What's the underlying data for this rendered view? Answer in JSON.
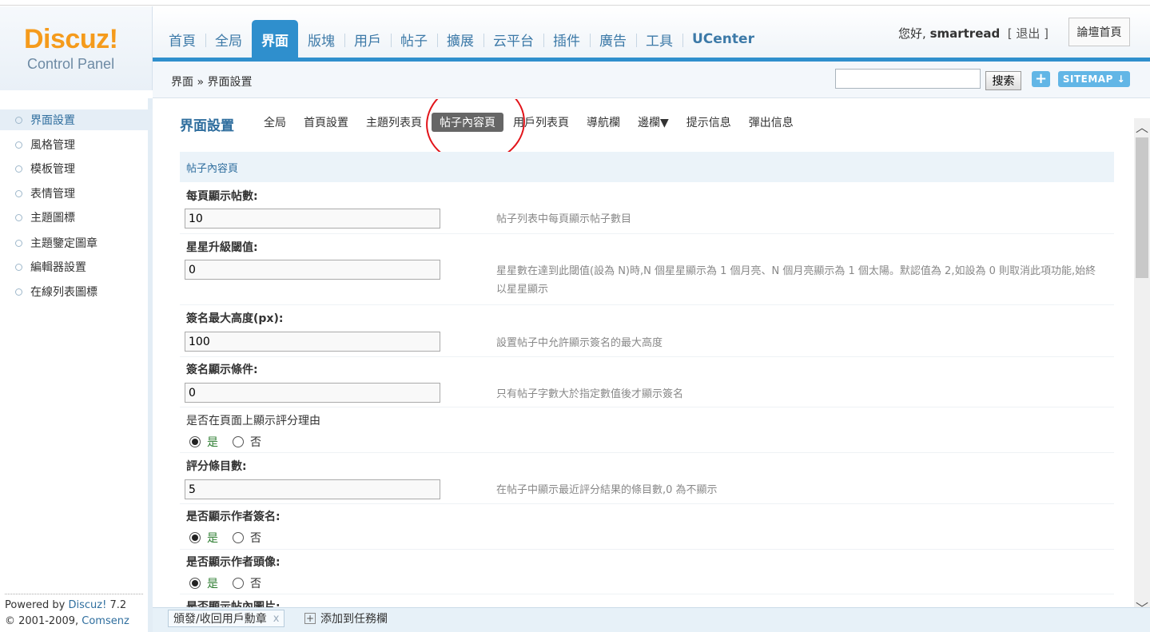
{
  "logo": {
    "brand": "Discuz!",
    "subtitle": "Control Panel"
  },
  "nav": {
    "items": [
      "首頁",
      "全局",
      "界面",
      "版塊",
      "用戶",
      "帖子",
      "擴展",
      "云平台",
      "插件",
      "廣告",
      "工具",
      "UCenter"
    ],
    "active": "界面"
  },
  "user": {
    "greeting": "您好,",
    "name": "smartread",
    "logout": "[ 退出 ]",
    "home_button": "論壇首頁"
  },
  "breadcrumb": "界面 » 界面設置",
  "search": {
    "value": "",
    "button": "搜索"
  },
  "plus_button": "+",
  "sitemap_button": "SITEMAP ↓",
  "sidebar": {
    "items": [
      "界面設置",
      "風格管理",
      "模板管理",
      "表情管理",
      "主題圖標",
      "主題鑒定圖章",
      "編輯器設置",
      "在線列表圖標"
    ],
    "active": "界面設置"
  },
  "footer": {
    "powered_prefix": "Powered by ",
    "powered_brand": "Discuz!",
    "powered_version": " 7.2",
    "copyright_prefix": "© 2001-2009, ",
    "copyright_company": "Comsenz Inc."
  },
  "page": {
    "title": "界面設置",
    "subtabs": [
      "全局",
      "首頁設置",
      "主題列表頁",
      "帖子內容頁",
      "用戶列表頁",
      "導航欄",
      "邊欄▼",
      "提示信息",
      "彈出信息"
    ],
    "active_subtab": "帖子內容頁",
    "section": "帖子內容頁"
  },
  "settings": {
    "per_page": {
      "label": "每頁顯示帖數:",
      "value": "10",
      "hint": "帖子列表中每頁顯示帖子數目"
    },
    "star_threshold": {
      "label": "星星升級閾值:",
      "value": "0",
      "hint": "星星數在達到此閾值(設為 N)時,N 個星星顯示為 1 個月亮、N 個月亮顯示為 1 個太陽。默認值為 2,如設為 0 則取消此項功能,始終以星星顯示"
    },
    "sig_max_height": {
      "label": "簽名最大高度(px):",
      "value": "100",
      "hint": "設置帖子中允許顯示簽名的最大高度"
    },
    "sig_condition": {
      "label": "簽名顯示條件:",
      "value": "0",
      "hint": "只有帖子字數大於指定數值後才顯示簽名"
    },
    "show_rate_reason": {
      "label": "是否在頁面上顯示評分理由",
      "yes": "是",
      "no": "否"
    },
    "rate_count": {
      "label": "評分條目數:",
      "value": "5",
      "hint": "在帖子中顯示最近評分結果的條目數,0 為不顯示"
    },
    "show_author_sig": {
      "label": "是否顯示作者簽名:",
      "yes": "是",
      "no": "否"
    },
    "show_author_avatar": {
      "label": "是否顯示作者頭像:",
      "yes": "是",
      "no": "否"
    },
    "show_images_partial": {
      "label": "是否顯示帖內圖片:"
    }
  },
  "taskbar": {
    "task1": "頒發/收回用戶勳章",
    "task1_close": "x",
    "add_task": "添加到任務欄",
    "add_icon": "+"
  },
  "scrollbar": {
    "up": "︿",
    "down": "﹀"
  },
  "colors": {
    "accent": "#2f8fcd",
    "logo_orange": "#f59b1c",
    "annotation_red": "#e2141a"
  }
}
